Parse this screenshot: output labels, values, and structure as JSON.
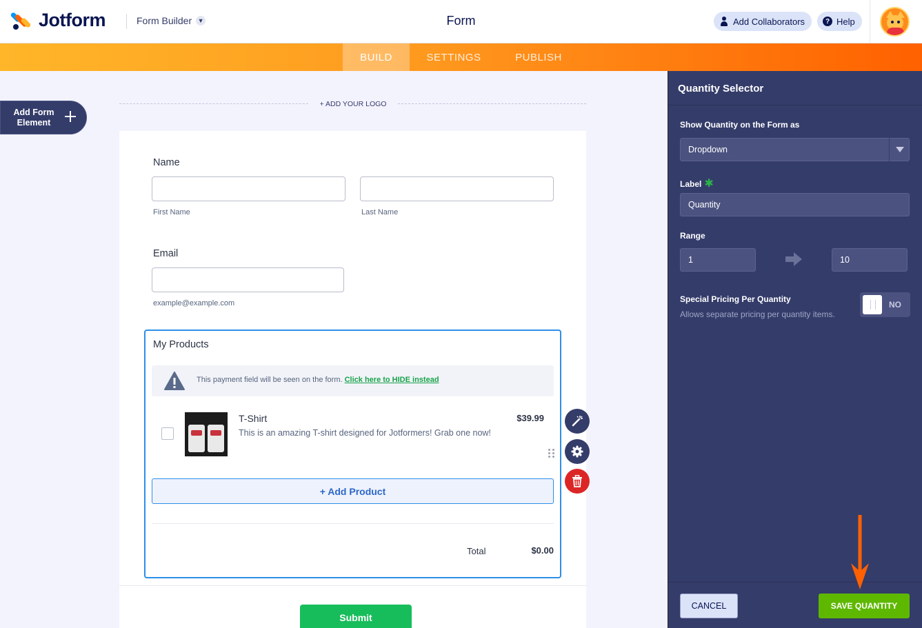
{
  "app": {
    "brand": "Jotform",
    "builder_menu": "Form Builder",
    "title": "Form"
  },
  "header": {
    "add_collaborators": "Add Collaborators",
    "help": "Help"
  },
  "nav": {
    "tabs": [
      "BUILD",
      "SETTINGS",
      "PUBLISH"
    ],
    "active": "BUILD"
  },
  "sidebar": {
    "add_element_label": "Add Form Element"
  },
  "form": {
    "add_logo": "+ ADD YOUR LOGO",
    "name_label": "Name",
    "first_name_sub": "First Name",
    "last_name_sub": "Last Name",
    "email_label": "Email",
    "email_sub": "example@example.com",
    "products_label": "My Products",
    "warning_text": "This payment field will be seen on the form.",
    "warning_link": "Click here to HIDE instead",
    "product": {
      "name": "T-Shirt",
      "description": "This is an amazing T-shirt designed for Jotformers! Grab one now!",
      "price": "$39.99"
    },
    "add_product": "+ Add Product",
    "total_label": "Total",
    "total_value": "$0.00",
    "submit": "Submit"
  },
  "panel": {
    "title": "Quantity Selector",
    "show_as_label": "Show Quantity on the Form as",
    "show_as_value": "Dropdown",
    "label_label": "Label",
    "label_value": "Quantity",
    "range_label": "Range",
    "range_min": "1",
    "range_max": "10",
    "special_pricing_label": "Special Pricing Per Quantity",
    "special_pricing_help": "Allows separate pricing per quantity items.",
    "toggle_state": "NO",
    "cancel": "CANCEL",
    "save": "SAVE QUANTITY"
  },
  "colors": {
    "brand_navy": "#0a1551",
    "nav_orange": "#ff6100",
    "panel_bg": "#343c6a",
    "selected_border": "#2d8ee8",
    "submit_green": "#18bd5b",
    "save_green": "#5fb800",
    "delete_red": "#dc2626",
    "hint_arrow": "#ff6100"
  }
}
